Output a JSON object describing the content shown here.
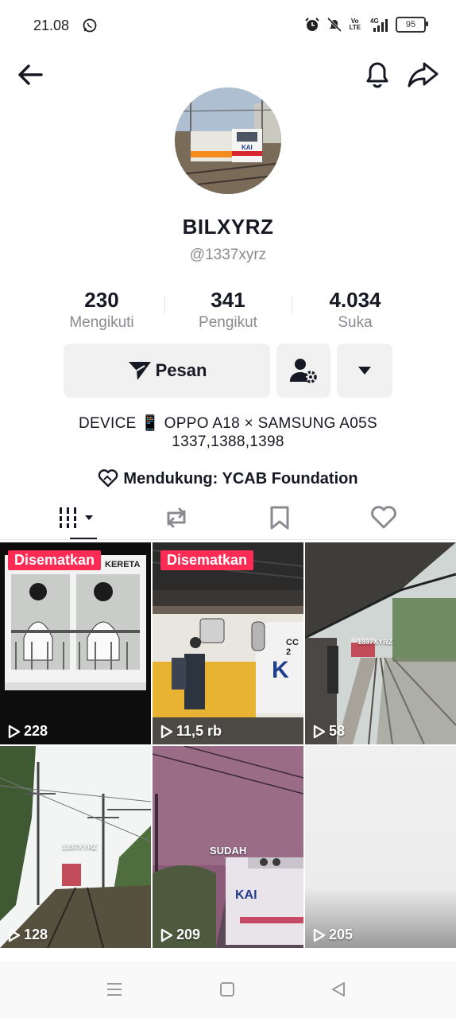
{
  "status_bar": {
    "time": "21.08",
    "battery": "95",
    "network": "4G"
  },
  "profile": {
    "username": "BILXYRZ",
    "handle": "@1337xyrz"
  },
  "stats": [
    {
      "value": "230",
      "label": "Mengikuti"
    },
    {
      "value": "341",
      "label": "Pengikut"
    },
    {
      "value": "4.034",
      "label": "Suka"
    }
  ],
  "actions": {
    "message_label": "Pesan"
  },
  "bio": {
    "line1": "DEVICE 📱 OPPO A18 × SAMSUNG A05S",
    "line2": "1337,1388,1398"
  },
  "support": {
    "text": "Mendukung: YCAB Foundation"
  },
  "tabs": [
    "videos",
    "reposts",
    "favorites",
    "liked"
  ],
  "videos": [
    {
      "views": "228",
      "pinned_label": "Disematkan",
      "overlay": "KERETA"
    },
    {
      "views": "11,5 rb",
      "pinned_label": "Disematkan",
      "overlay": "CC 2"
    },
    {
      "views": "58",
      "overlay": "1337XYRZ"
    },
    {
      "views": "128",
      "overlay": "1337XYRZ"
    },
    {
      "views": "209",
      "overlay": "SUDAH"
    },
    {
      "views": "205"
    }
  ],
  "colors": {
    "accent": "#fe2c55",
    "text_primary": "#161823",
    "text_secondary": "#8a8b91",
    "button_bg": "#f1f1f2"
  }
}
